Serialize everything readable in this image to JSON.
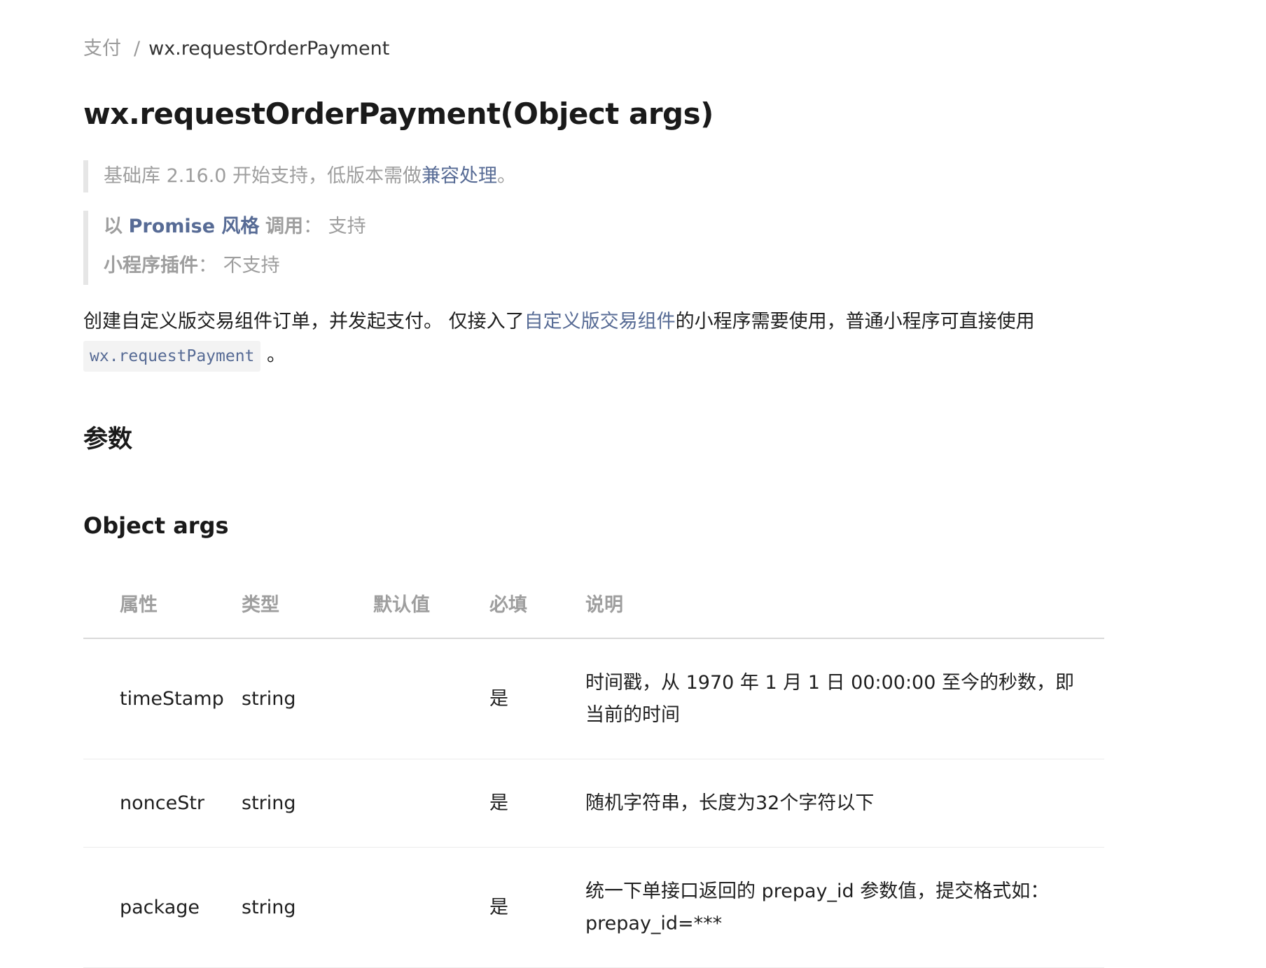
{
  "breadcrumb": {
    "parent": "支付",
    "separator": "/",
    "current": "wx.requestOrderPayment"
  },
  "title": "wx.requestOrderPayment(Object args)",
  "support_note": {
    "prefix": "基础库 2.16.0 开始支持，低版本需做",
    "link": "兼容处理",
    "suffix": "。"
  },
  "promise_note": {
    "prefix": "以",
    "link": "Promise 风格",
    "label": "调用",
    "colon": "：",
    "value": "支持"
  },
  "plugin_note": {
    "label": "小程序插件",
    "colon": "：",
    "value": "不支持"
  },
  "description": {
    "text1": "创建自定义版交易组件订单，并发起支付。 仅接入了",
    "link": "自定义版交易组件",
    "text2": "的小程序需要使用，普通小程序可直接使用 ",
    "code": "wx.requestPayment",
    "end": " 。"
  },
  "section_heading": "参数",
  "subsection_heading": "Object args",
  "table": {
    "headers": [
      "属性",
      "类型",
      "默认值",
      "必填",
      "说明"
    ],
    "rows": [
      {
        "name": "timeStamp",
        "type": "string",
        "default": "",
        "required": "是",
        "desc": "时间戳，从 1970 年 1 月 1 日 00:00:00 至今的秒数，即当前的时间"
      },
      {
        "name": "nonceStr",
        "type": "string",
        "default": "",
        "required": "是",
        "desc": "随机字符串，长度为32个字符以下"
      },
      {
        "name": "package",
        "type": "string",
        "default": "",
        "required": "是",
        "desc": "统一下单接口返回的 prepay_id 参数值，提交格式如：prepay_id=***"
      }
    ]
  },
  "colors": {
    "link": "#576b95",
    "muted": "#9e9e9e",
    "text": "#1f1f1f",
    "quote_border": "#e6e6e6"
  }
}
